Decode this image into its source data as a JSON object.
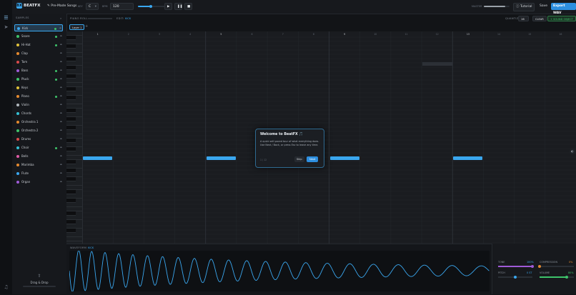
{
  "app": {
    "logo_text": "BX",
    "name": "BEATFX"
  },
  "toolbar": {
    "premade_label": "Pre-Made Songs",
    "key_label": "KEY",
    "key_value": "C",
    "bpm_label": "BPM",
    "bpm_value": "120",
    "master_label": "MASTER",
    "tutorial_label": "Tutorial",
    "save_label": "Save",
    "export_label": "Export WAV",
    "quantize_label": "QUANTIZE",
    "quantize_value": "16",
    "clear_label": "CLEAR",
    "sound_object_label": "+ SOUND OBJECT"
  },
  "colors": {
    "accent": "#3aa7ef",
    "active_dot": "#3ec36a",
    "export_bg": "#2d8fe0"
  },
  "samples": {
    "title": "SAMPLES",
    "items": [
      {
        "name": "Kick",
        "color": "#3aa7ef",
        "green": true,
        "active": true
      },
      {
        "name": "Snare",
        "color": "#3ec36a",
        "green": true
      },
      {
        "name": "Hi-Hat",
        "color": "#e0c23a",
        "green": true
      },
      {
        "name": "Clap",
        "color": "#e58a2f",
        "green": false
      },
      {
        "name": "Tom",
        "color": "#d84b4b",
        "green": false
      },
      {
        "name": "Bass",
        "color": "#9f5bd8",
        "green": true
      },
      {
        "name": "Pluck",
        "color": "#3ec36a",
        "green": true
      },
      {
        "name": "Keys",
        "color": "#e0c23a",
        "green": false
      },
      {
        "name": "Piano",
        "color": "#e58a2f",
        "green": true
      },
      {
        "name": "Violin",
        "color": "#b0b6bd",
        "green": false
      },
      {
        "name": "Chords",
        "color": "#35c0d3",
        "green": false
      },
      {
        "name": "Orchestra 1",
        "color": "#e58a2f",
        "green": false
      },
      {
        "name": "Orchestra 2",
        "color": "#3ec36a",
        "green": false
      },
      {
        "name": "Drums",
        "color": "#d84b4b",
        "green": false
      },
      {
        "name": "Choir",
        "color": "#35c0d3",
        "green": true
      },
      {
        "name": "Bells",
        "color": "#e05aa6",
        "green": false
      },
      {
        "name": "Marimba",
        "color": "#e58a2f",
        "green": false
      },
      {
        "name": "Flute",
        "color": "#3aa7ef",
        "green": false
      },
      {
        "name": "Organ",
        "color": "#9f5bd8",
        "green": false
      }
    ],
    "drag_title": "Drag & Drop"
  },
  "roll": {
    "title": "PIANO ROLL",
    "edit_label": "EDIT: ",
    "edit_value": "KICK",
    "layer_tab": "Layer 1",
    "add_layer": "+",
    "bar_numbers": [
      "1",
      "2",
      "3",
      "4",
      "5",
      "6",
      "7",
      "8",
      "9",
      "10",
      "11",
      "12",
      "13",
      "14",
      "15",
      "16"
    ],
    "note_steps": [
      1,
      5,
      9,
      13
    ]
  },
  "modal": {
    "title": "Welcome to BeatFX 🎵",
    "body": "A quick self-paced tour of what everything does. Use Next / Back, or press Esc to leave any time.",
    "step": "1 / 12",
    "skip_label": "Skip",
    "next_label": "Next"
  },
  "waveform": {
    "title": "WAVEFORM",
    "subtitle": "KICK"
  },
  "fx": {
    "tone_label": "TONE",
    "tone_value": "100%",
    "tone_level": 1.0,
    "compression_label": "COMPRESSION",
    "compression_value": "0%",
    "compression_level": 0.0,
    "pitch_label": "PITCH",
    "pitch_value": "0 ST",
    "pitch_level": 0.5,
    "volume_label": "VOLUME",
    "volume_value": "80%",
    "volume_level": 0.8
  }
}
